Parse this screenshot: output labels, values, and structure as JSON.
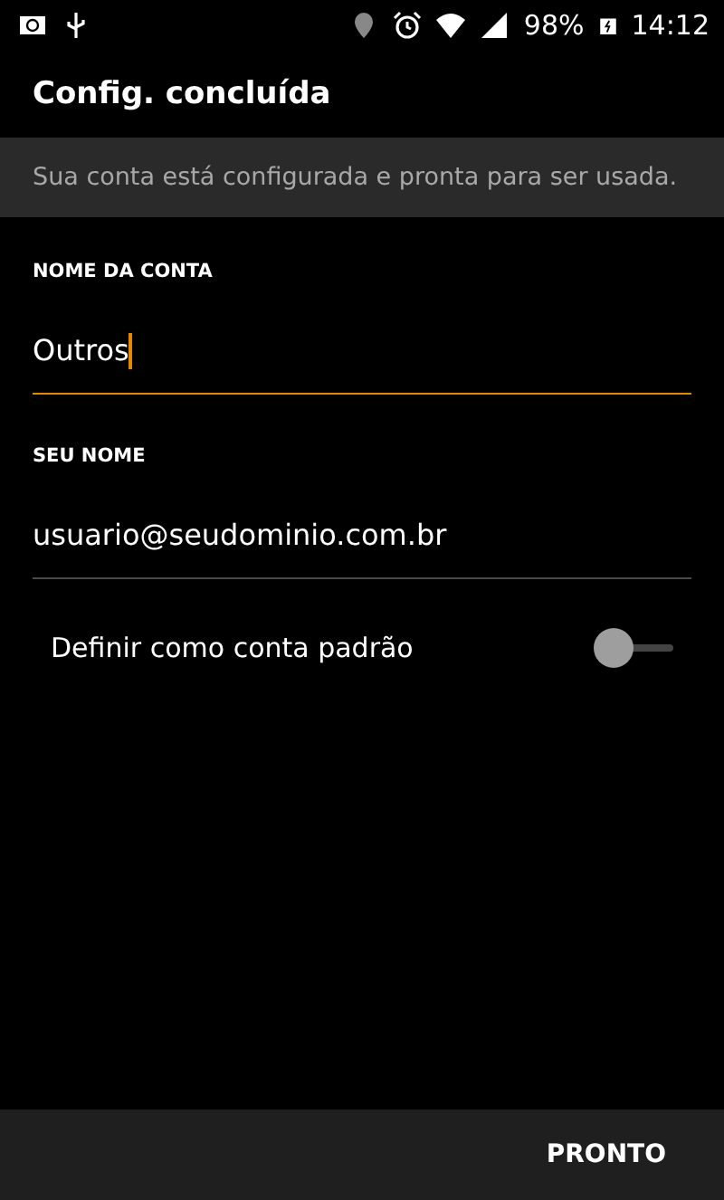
{
  "status_bar": {
    "battery": "98%",
    "time": "14:12"
  },
  "title": "Config. concluída",
  "banner": "Sua conta está configurada e pronta para ser usada.",
  "fields": [
    {
      "label": "NOME DA CONTA",
      "value": "Outros",
      "focused": true
    },
    {
      "label": "SEU NOME",
      "value": "usuario@seudominio.com.br",
      "focused": false
    }
  ],
  "toggle": {
    "label": "Definir como conta padrão",
    "on": false
  },
  "footer": {
    "button": "PRONTO"
  }
}
